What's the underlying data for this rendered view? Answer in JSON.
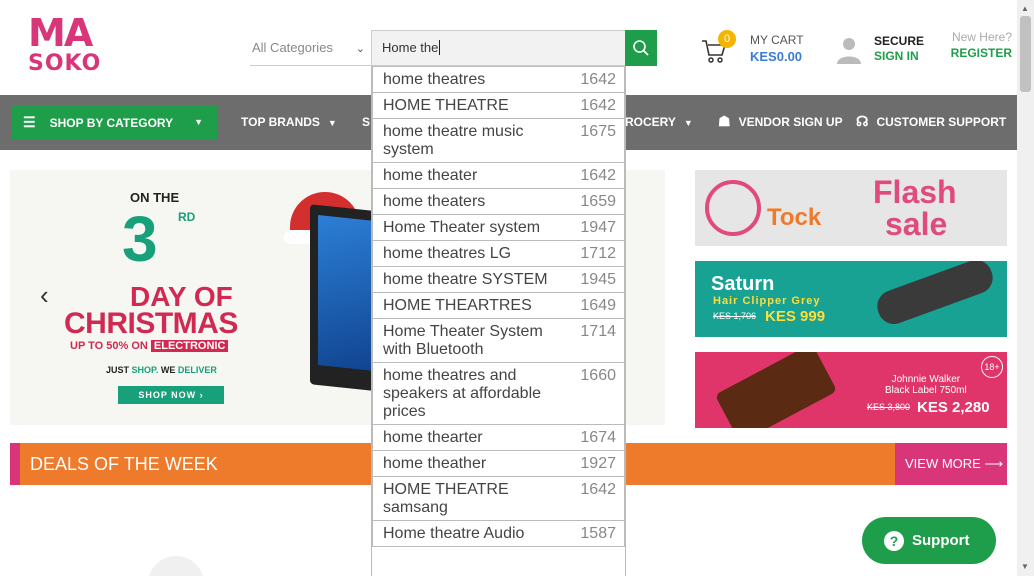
{
  "header": {
    "logo_top": "MA",
    "logo_bottom": "SOKO",
    "category_select": "All Categories",
    "search_value": "Home the",
    "cart_count": "0",
    "cart_title": "MY CART",
    "cart_total": "KES0.00",
    "secure_label": "SECURE",
    "signin_label": "SIGN IN",
    "new_here": "New Here?",
    "register_label": "REGISTER"
  },
  "nav": {
    "shop_by_category": "SHOP BY CATEGORY",
    "top_brands": "TOP BRANDS",
    "partial_s": "S",
    "grocery": "ROCERY",
    "vendor_signup": "VENDOR SIGN UP",
    "customer_support": "CUSTOMER SUPPORT"
  },
  "hero": {
    "on_the": "ON THE",
    "number": "3",
    "ordinal": "RD",
    "day_of": "DAY OF",
    "christmas": "CHRISTMAS",
    "upto": "UP TO 50% ON",
    "electronic": "ELECTRONIC",
    "just": "JUST",
    "shop": "SHOP.",
    "we": "WE",
    "deliver": "DELIVER",
    "shop_now": "SHOP NOW ›"
  },
  "banners": {
    "tock": "Tock",
    "flash": "Flash",
    "sale": "sale",
    "saturn_name": "Saturn",
    "saturn_sub": "Hair Clipper Grey",
    "saturn_old": "KES 1,706",
    "saturn_new": "KES 999",
    "jw_title_1": "Johnnie Walker",
    "jw_title_2": "Black Label 750ml",
    "jw_old": "KES 3,800",
    "jw_new": "KES 2,280",
    "age": "18+"
  },
  "deals": {
    "title": "DEALS OF THE WEEK",
    "view_more": "VIEW MORE ⟶"
  },
  "suggestions": [
    {
      "text": "home theatres",
      "count": "1642"
    },
    {
      "text": "HOME THEATRE",
      "count": "1642"
    },
    {
      "text": "home theatre music system",
      "count": "1675"
    },
    {
      "text": "home theater",
      "count": "1642"
    },
    {
      "text": "home theaters",
      "count": "1659"
    },
    {
      "text": "Home Theater system",
      "count": "1947"
    },
    {
      "text": "home theatres LG",
      "count": "1712"
    },
    {
      "text": "home theatre SYSTEM",
      "count": "1945"
    },
    {
      "text": "HOME THEARTRES",
      "count": "1649"
    },
    {
      "text": "Home Theater System with Bluetooth",
      "count": "1714"
    },
    {
      "text": "home theatres and speakers at affordable prices",
      "count": "1660"
    },
    {
      "text": "home thearter",
      "count": "1674"
    },
    {
      "text": "home theather",
      "count": "1927"
    },
    {
      "text": "HOME THEATRE samsang",
      "count": "1642"
    },
    {
      "text": "Home theatre Audio",
      "count": "1587"
    }
  ],
  "support_label": "Support",
  "colors": {
    "brand_green": "#1e9e4a",
    "brand_pink": "#d9367a",
    "deals_orange": "#ee7a2b",
    "nav_grey": "#6d6d6d"
  }
}
